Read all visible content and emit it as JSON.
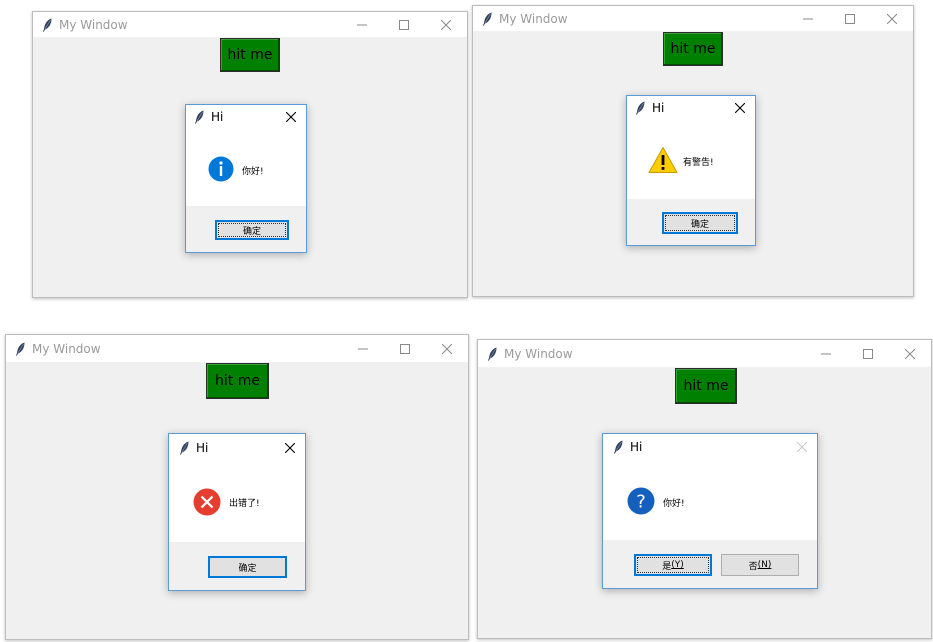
{
  "windows": [
    {
      "title": "My Window",
      "hit_button": "hit me",
      "dialog": {
        "title": "Hi",
        "icon": "info-icon",
        "message": "你好!",
        "buttons": [
          "确定"
        ]
      }
    },
    {
      "title": "My Window",
      "hit_button": "hit me",
      "dialog": {
        "title": "Hi",
        "icon": "warning-icon",
        "message": "有警告!",
        "buttons": [
          "确定"
        ]
      }
    },
    {
      "title": "My Window",
      "hit_button": "hit me",
      "dialog": {
        "title": "Hi",
        "icon": "error-icon",
        "message": "出错了!",
        "buttons": [
          "确定"
        ]
      }
    },
    {
      "title": "My Window",
      "hit_button": "hit me",
      "dialog": {
        "title": "Hi",
        "icon": "question-icon",
        "message": "你好!",
        "yes_button": {
          "label": "是",
          "accel": "(Y)"
        },
        "no_button": {
          "label": "否",
          "accel": "(N)"
        }
      }
    }
  ],
  "colors": {
    "hit_button_bg": "#008000",
    "dialog_border": "#5b9bd5",
    "focus_border": "#0078d7",
    "info": "#0078d7",
    "warning": "#ffcc00",
    "error": "#e81123",
    "window_bg": "#f0f0f0"
  }
}
